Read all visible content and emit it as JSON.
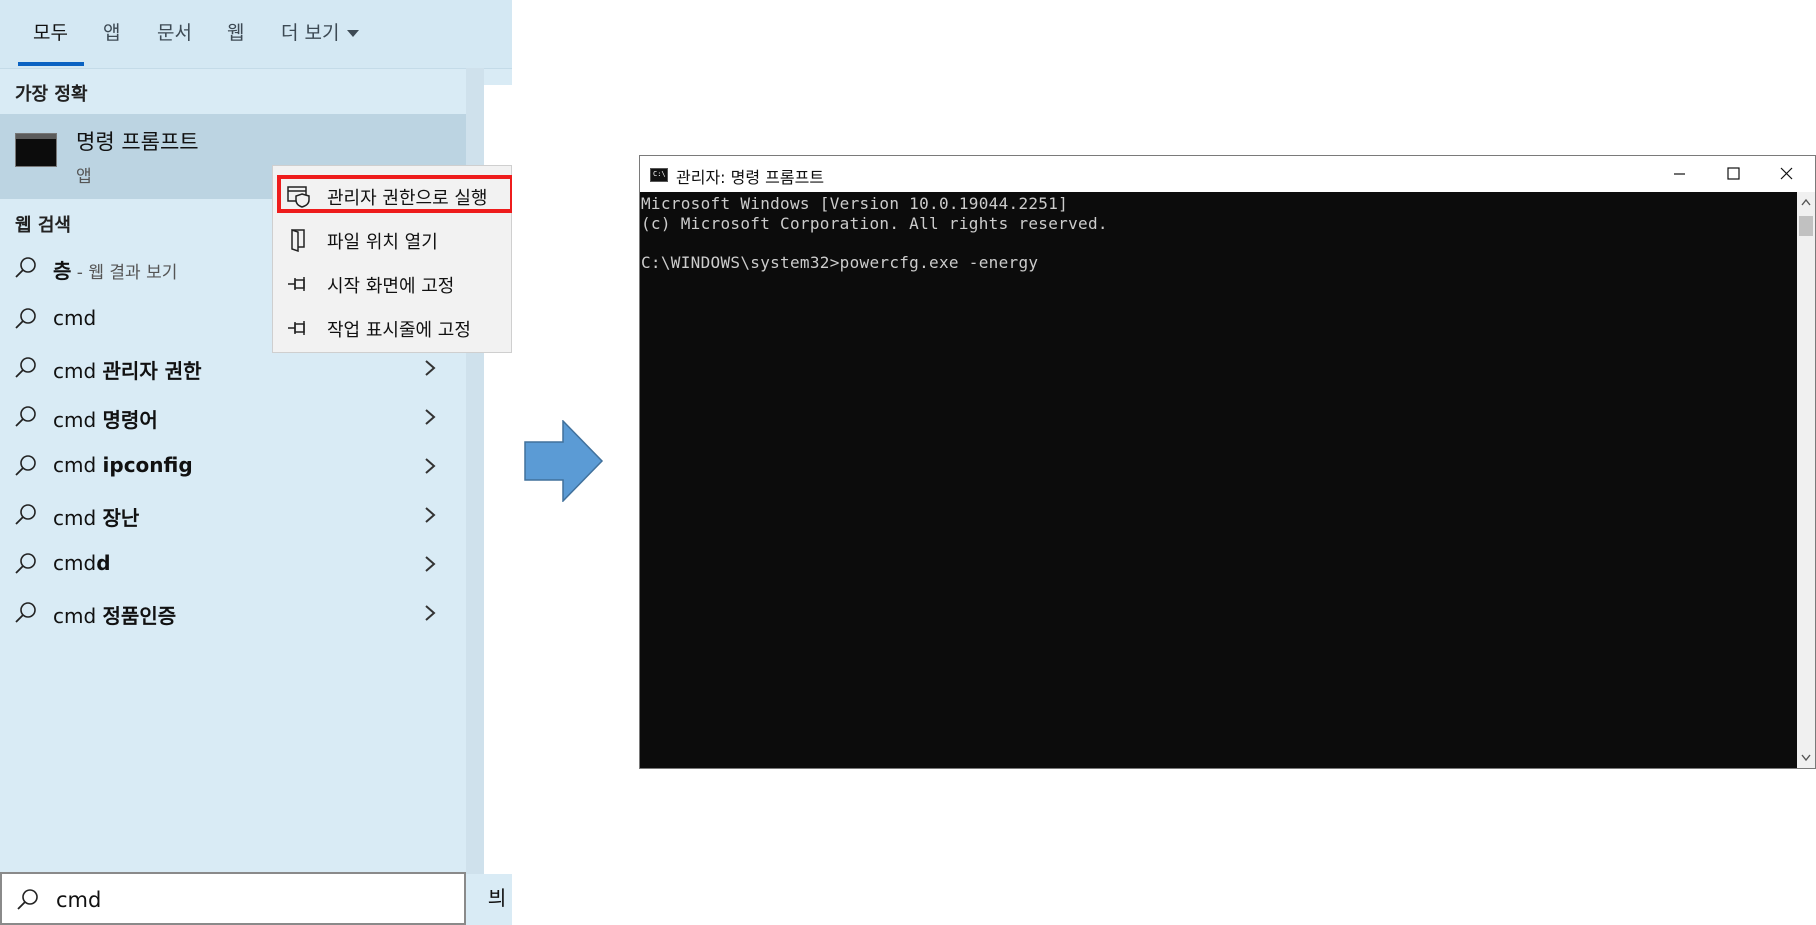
{
  "search_panel": {
    "tabs": [
      {
        "label": "모두",
        "active": true
      },
      {
        "label": "앱"
      },
      {
        "label": "문서"
      },
      {
        "label": "웹"
      },
      {
        "label": "더 보기"
      }
    ],
    "best_match_label": "가장 정확",
    "best_match": {
      "name": "명령 프롬프트",
      "type": "앱"
    },
    "web_search_label": "웹 검색",
    "results": [
      {
        "bold": "층",
        "sub": " - 웹 결과 보기"
      },
      {
        "plain": "cmd"
      },
      {
        "plain": "cmd ",
        "bold": "관리자 권한"
      },
      {
        "plain": "cmd ",
        "bold": "명령어"
      },
      {
        "plain": "cmd ",
        "bold": "ipconfig"
      },
      {
        "plain": "cmd ",
        "bold": "장난"
      },
      {
        "plain": "cmd",
        "bold": "d"
      },
      {
        "plain": "cmd ",
        "bold": "정품인증"
      }
    ],
    "context_menu": [
      {
        "label": "관리자 권한으로 실행",
        "icon": "shield-window-icon"
      },
      {
        "label": "파일 위치 열기",
        "icon": "folder-icon"
      },
      {
        "label": "시작 화면에 고정",
        "icon": "pin-icon"
      },
      {
        "label": "작업 표시줄에 고정",
        "icon": "pin-icon"
      }
    ],
    "search": {
      "value": "cmd"
    },
    "side_glyph": "븨"
  },
  "cmd_window": {
    "title": "관리자: 명령 프롬프트",
    "icon_text": "C:\\",
    "console_lines": [
      "Microsoft Windows [Version 10.0.19044.2251]",
      "(c) Microsoft Corporation. All rights reserved.",
      "",
      "C:\\WINDOWS\\system32>powercfg.exe -energy"
    ]
  },
  "colors": {
    "panel_bg": "#d9ebf5",
    "tab_underline": "#0a62c2",
    "highlight": "#ee1c1c",
    "arrow": "#5b9bd5",
    "console_bg": "#0c0c0c",
    "console_text": "#cccccc"
  }
}
